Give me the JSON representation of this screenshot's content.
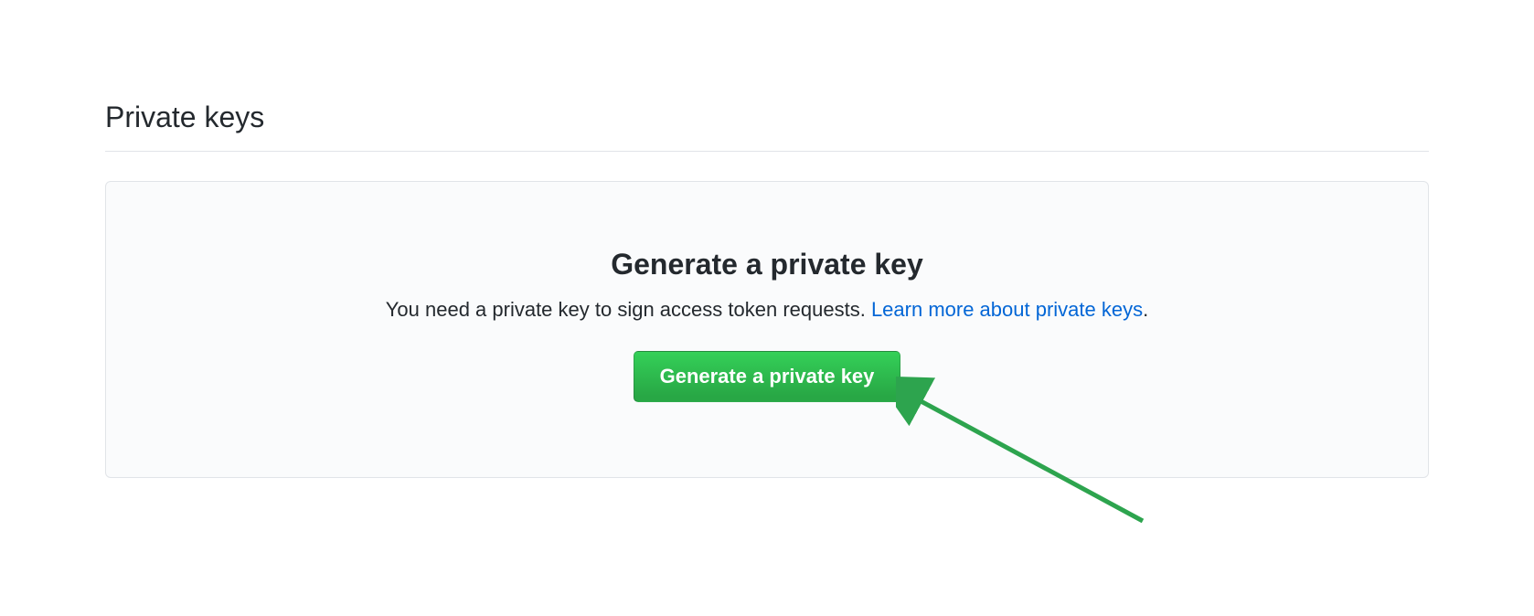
{
  "section": {
    "heading": "Private keys"
  },
  "panel": {
    "heading": "Generate a private key",
    "desc_text": "You need a private key to sign access token requests. ",
    "desc_link": "Learn more about private keys",
    "desc_end": ".",
    "button_label": "Generate a private key"
  }
}
